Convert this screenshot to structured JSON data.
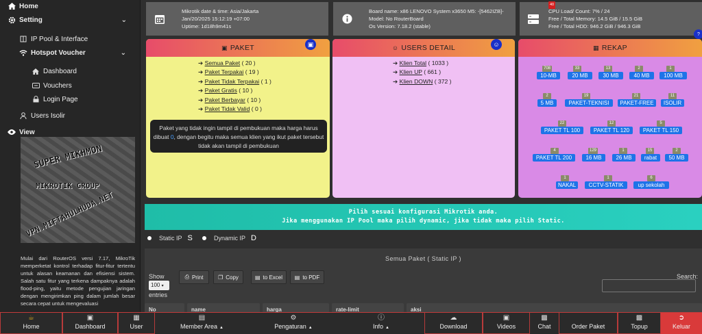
{
  "sidebar": {
    "home": "Home",
    "setting": "Setting",
    "ip_pool": "IP Pool & Interface",
    "hotspot": "Hotspot Voucher",
    "dashboard": "Dashboard",
    "vouchers": "Vouchers",
    "login_page": "Login Page",
    "users_isolir": "Users Isolir",
    "view": "View",
    "logo_lines": [
      "SUPER MIKHMON",
      "MIKROTIK GROUP",
      "VPN.MIFTAHULHUDA.NET"
    ],
    "description": "Mulai dari RouterOS versi 7.17, MikroTik memperketat kontrol terhadap fitur-fitur tertentu untuk alasan keamanan dan efisiensi sistem. Salah satu fitur yang terkena dampaknya adalah flood-ping, yaitu metode pengujian jaringan dengan mengirimkan ping dalam jumlah besar secara cepat untuk mengevaluasi"
  },
  "info": {
    "clock": {
      "l1": "Mikrotik date & time: Asia/Jakarta",
      "l2": "Jan/20/2025 15:12:19 +07:00",
      "l3": "Uptime: 1d18h9m41s"
    },
    "board": {
      "l1": "Board name: x86 LENOVO System x3650 M5: -[5462IZB]-",
      "l2": "Model: No RouterBoard",
      "l3": "Os Version: 7.18.2 (stable)"
    },
    "resource": {
      "l1": "CPU Load/ Count: 7% / 24",
      "l2": "Free / Total Memory: 14.5 GiB / 15.5 GiB",
      "l3": "Free / Total HDD: 946.2 GiB / 946.3 GiB",
      "badge": "40"
    }
  },
  "paket": {
    "title": "PAKET",
    "items": [
      {
        "label": "Semua Paket",
        "count": "( 20 )"
      },
      {
        "label": "Paket Terpakai",
        "count": "( 19 )"
      },
      {
        "label": "Paket Tidak Terpakai",
        "count": "( 1 )"
      },
      {
        "label": "Paket Gratis",
        "count": "( 10 )"
      },
      {
        "label": "Paket Berbayar",
        "count": "( 10 )"
      },
      {
        "label": "Paket Tidak Valid",
        "count": "( 0 )"
      }
    ],
    "note_a": "Paket yang tidak ingin tampil di pembukuan maka harga harus dibuat ",
    "note_zero": "0",
    "note_b": ", dengan begitu maka semua klien yang ikut paket tersebut tidak akan tampil di pembukuan"
  },
  "users": {
    "title": "USERS DETAIL",
    "items": [
      {
        "label": "Klien Total",
        "count": "( 1033 )"
      },
      {
        "label": "Klien UP",
        "count": "( 661 )"
      },
      {
        "label": "Klien DOWN",
        "count": "( 372 )"
      }
    ]
  },
  "rekap": {
    "title": "REKAP",
    "tags": [
      {
        "label": "10-MB",
        "count": "708"
      },
      {
        "label": "20 MB",
        "count": "33"
      },
      {
        "label": "30 MB",
        "count": "13"
      },
      {
        "label": "40 MB",
        "count": "2"
      },
      {
        "label": "100 MB",
        "count": "1"
      },
      {
        "label": "5 MB",
        "count": "2"
      },
      {
        "label": "PAKET-TEKNISI",
        "count": "19"
      },
      {
        "label": "PAKET-FREE",
        "count": "21"
      },
      {
        "label": "ISOLIR",
        "count": "11"
      },
      {
        "label": "PAKET TL 100",
        "count": "22"
      },
      {
        "label": "PAKET TL 120",
        "count": "12"
      },
      {
        "label": "PAKET TL 150",
        "count": "5"
      },
      {
        "label": "PAKET TL 200",
        "count": "4"
      },
      {
        "label": "16 MB",
        "count": "129"
      },
      {
        "label": "26 MB",
        "count": "1"
      },
      {
        "label": "rabat",
        "count": "15"
      },
      {
        "label": "50 MB",
        "count": "2"
      },
      {
        "label": "NAKAL",
        "count": "1"
      },
      {
        "label": "CCTV-STATIK",
        "count": "1"
      },
      {
        "label": "up sekolah",
        "count": "6"
      }
    ]
  },
  "banner": {
    "l1": "Pilih sesuai konfigurasi Mikrotik anda.",
    "l2": "Jika menggunakan IP Pool maka pilih dynamic, jika tidak maka pilih Static."
  },
  "radios": {
    "static": "Static IP",
    "static_k": "S",
    "dynamic": "Dynamic IP",
    "dynamic_k": "D"
  },
  "table": {
    "title": "Semua Paket ( Static IP )",
    "show": "Show",
    "length": "100",
    "entries": "entries",
    "print": "Print",
    "copy": "Copy",
    "excel": "to Excel",
    "pdf": "to PDF",
    "search": "Search:",
    "cols": [
      "No",
      "name",
      "harga",
      "rate-limit",
      "aksi"
    ]
  },
  "bottom": {
    "home": "Home",
    "dashboard": "Dashboard",
    "user": "User",
    "member": "Member Area",
    "pengaturan": "Pengaturan",
    "info": "Info",
    "download": "Download",
    "videos": "Videos",
    "chat": "Chat",
    "order": "Order Paket",
    "topup": "Topup",
    "keluar": "Keluar"
  }
}
